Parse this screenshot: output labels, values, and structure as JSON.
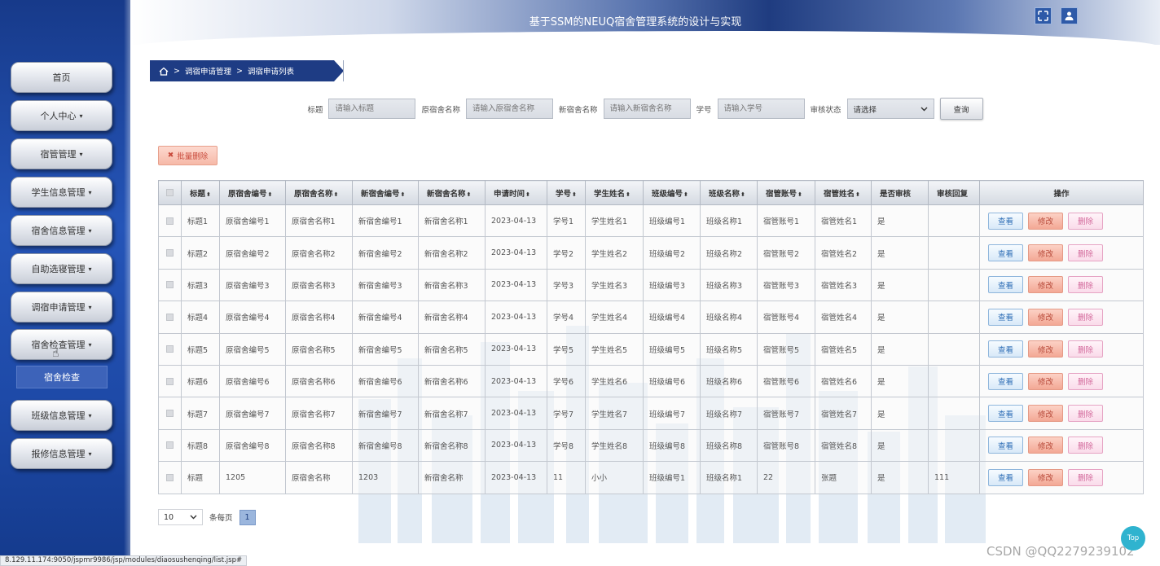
{
  "app": {
    "title": "基于SSM的NEUQ宿舍管理系统的设计与实现"
  },
  "header": {
    "icons": [
      "fullscreen-icon",
      "user-icon"
    ]
  },
  "sidebar": {
    "items": [
      {
        "label": "首页",
        "caret": ""
      },
      {
        "label": "个人中心",
        "caret": "▾"
      },
      {
        "label": "宿管管理",
        "caret": "▾"
      },
      {
        "label": "学生信息管理",
        "caret": "▾"
      },
      {
        "label": "宿舍信息管理",
        "caret": "▾"
      },
      {
        "label": "自助选寝管理",
        "caret": "▾"
      },
      {
        "label": "调宿申请管理",
        "caret": "▾"
      },
      {
        "label": "宿舍检查管理",
        "caret": "▾"
      },
      {
        "label": "班级信息管理",
        "caret": "▾"
      },
      {
        "label": "报修信息管理",
        "caret": "▾"
      }
    ],
    "sub_item": {
      "label": "宿舍检查"
    }
  },
  "breadcrumb": {
    "sep": ">",
    "level1": "调宿申请管理",
    "level2": "调宿申请列表"
  },
  "filters": {
    "title_label": "标题",
    "title_placeholder": "请输入标题",
    "old_name_label": "原宿舍名称",
    "old_name_placeholder": "请输入原宿舍名称",
    "new_name_label": "新宿舍名称",
    "new_name_placeholder": "请输入新宿舍名称",
    "student_no_label": "学号",
    "student_no_placeholder": "请输入学号",
    "status_label": "审核状态",
    "status_value": "请选择",
    "search_label": "查询"
  },
  "toolbar": {
    "batch_delete_label": "批量删除"
  },
  "table": {
    "headers": [
      "标题",
      "原宿舍编号",
      "原宿舍名称",
      "新宿舍编号",
      "新宿舍名称",
      "申请时间",
      "学号",
      "学生姓名",
      "班级编号",
      "班级名称",
      "宿管账号",
      "宿管姓名",
      "是否审核",
      "审核回复",
      "操作"
    ],
    "sortable_mark": "⬍",
    "rows": [
      [
        "标题1",
        "原宿舍编号1",
        "原宿舍名称1",
        "新宿舍编号1",
        "新宿舍名称1",
        "2023-04-13",
        "学号1",
        "学生姓名1",
        "班级编号1",
        "班级名称1",
        "宿管账号1",
        "宿管姓名1",
        "是",
        ""
      ],
      [
        "标题2",
        "原宿舍编号2",
        "原宿舍名称2",
        "新宿舍编号2",
        "新宿舍名称2",
        "2023-04-13",
        "学号2",
        "学生姓名2",
        "班级编号2",
        "班级名称2",
        "宿管账号2",
        "宿管姓名2",
        "是",
        ""
      ],
      [
        "标题3",
        "原宿舍编号3",
        "原宿舍名称3",
        "新宿舍编号3",
        "新宿舍名称3",
        "2023-04-13",
        "学号3",
        "学生姓名3",
        "班级编号3",
        "班级名称3",
        "宿管账号3",
        "宿管姓名3",
        "是",
        ""
      ],
      [
        "标题4",
        "原宿舍编号4",
        "原宿舍名称4",
        "新宿舍编号4",
        "新宿舍名称4",
        "2023-04-13",
        "学号4",
        "学生姓名4",
        "班级编号4",
        "班级名称4",
        "宿管账号4",
        "宿管姓名4",
        "是",
        ""
      ],
      [
        "标题5",
        "原宿舍编号5",
        "原宿舍名称5",
        "新宿舍编号5",
        "新宿舍名称5",
        "2023-04-13",
        "学号5",
        "学生姓名5",
        "班级编号5",
        "班级名称5",
        "宿管账号5",
        "宿管姓名5",
        "是",
        ""
      ],
      [
        "标题6",
        "原宿舍编号6",
        "原宿舍名称6",
        "新宿舍编号6",
        "新宿舍名称6",
        "2023-04-13",
        "学号6",
        "学生姓名6",
        "班级编号6",
        "班级名称6",
        "宿管账号6",
        "宿管姓名6",
        "是",
        ""
      ],
      [
        "标题7",
        "原宿舍编号7",
        "原宿舍名称7",
        "新宿舍编号7",
        "新宿舍名称7",
        "2023-04-13",
        "学号7",
        "学生姓名7",
        "班级编号7",
        "班级名称7",
        "宿管账号7",
        "宿管姓名7",
        "是",
        ""
      ],
      [
        "标题8",
        "原宿舍编号8",
        "原宿舍名称8",
        "新宿舍编号8",
        "新宿舍名称8",
        "2023-04-13",
        "学号8",
        "学生姓名8",
        "班级编号8",
        "班级名称8",
        "宿管账号8",
        "宿管姓名8",
        "是",
        ""
      ],
      [
        "标题",
        "1205",
        "原宿舍名称",
        "1203",
        "新宿舍名称",
        "2023-04-13",
        "11",
        "小小",
        "班级编号1",
        "班级名称1",
        "22",
        "张题",
        "是",
        "111"
      ]
    ],
    "actions": {
      "view": "查看",
      "edit": "修改",
      "delete": "删除"
    }
  },
  "pagination": {
    "page_size": "10",
    "per_page_label": "条每页",
    "current_page": "1"
  },
  "status_bar": {
    "url": "8.129.11.174:9050/jspmr9986/jsp/modules/diaosushenqing/list.jsp#"
  },
  "watermark": {
    "text": "CSDN @QQ2279239102"
  },
  "top_button": {
    "label": "Top"
  },
  "colors": {
    "sidebar": "#2555b8",
    "header_dark": "#1f3c80",
    "breadcrumb": "#1e3c84",
    "view_btn": "#2c6cb5",
    "edit_btn": "#f3a895",
    "delete_btn": "#d2679a",
    "top_btn": "#2fb3cf"
  }
}
